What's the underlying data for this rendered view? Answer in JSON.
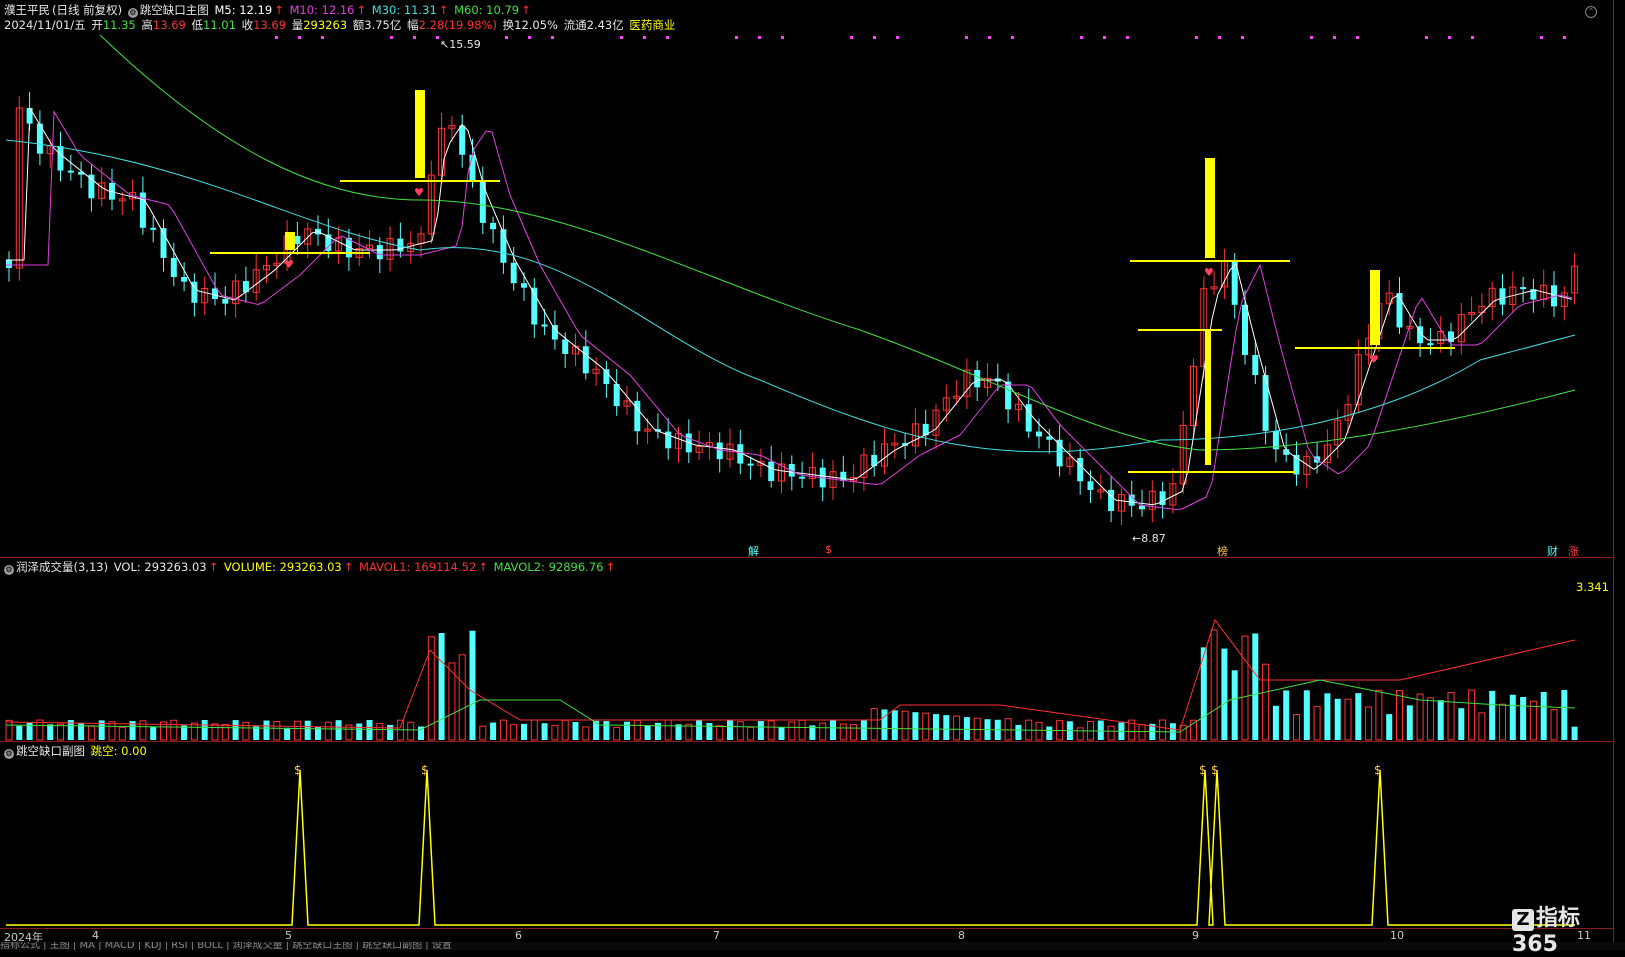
{
  "header": {
    "stock_name": "濮王平民",
    "period": "(日线 前复权)",
    "indicator_name": "跳空缺口主图",
    "ma": [
      {
        "label": "M5: 12.19",
        "color": "#ffffff"
      },
      {
        "label": "M10: 12.16",
        "color": "#e040e0"
      },
      {
        "label": "M30: 11.31",
        "color": "#40e0e0"
      },
      {
        "label": "M60: 10.79",
        "color": "#40e040"
      }
    ],
    "ohlc": {
      "date": "2024/11/01/五",
      "open_label": "开",
      "open": "11.35",
      "high_label": "高",
      "high": "13.69",
      "low_label": "低",
      "low": "11.01",
      "close_label": "收",
      "close": "13.69",
      "vol_label": "量",
      "vol": "293263",
      "amount_label": "额",
      "amount": "3.75亿",
      "change_label": "幅",
      "change": "2.28(19.98%)",
      "turnover": "换12.05%",
      "float": "流通2.43亿",
      "sector": "医药商业"
    },
    "high_mark": "15.59",
    "low_mark": "8.87"
  },
  "volume_panel": {
    "title": "润泽成交量(3,13)",
    "vol": "VOL: 293263.03",
    "volume": "VOLUME: 293263.03",
    "mavol1": "MAVOL1: 169114.52",
    "mavol2": "MAVOL2: 92896.76",
    "scale": "3.341"
  },
  "gap_panel": {
    "title": "跳空缺口副图",
    "value": "跳空: 0.00"
  },
  "x_axis": [
    "2024年",
    "4",
    "5",
    "6",
    "7",
    "8",
    "9",
    "10",
    "11"
  ],
  "event_marks": [
    "解",
    "$",
    "榜",
    "财",
    "涨"
  ],
  "watermark": "指标365",
  "bottom_text": "指标公式 | 主图 | MA | MACD | KDJ | RSI | BOLL | 润泽成交量 | 跳空缺口主图 | 跳空缺口副图 | 设置",
  "colors": {
    "up": "#ff3232",
    "down": "#54ffff",
    "gap": "#ffff00",
    "ma5": "#ffffff",
    "ma10": "#e040e0",
    "ma30": "#40e0e0",
    "ma60": "#40e040"
  }
}
